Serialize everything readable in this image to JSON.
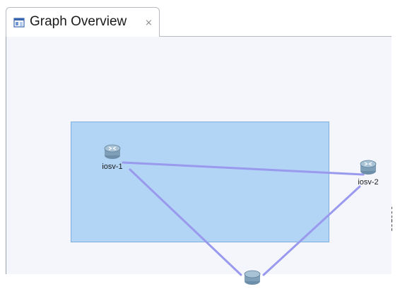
{
  "tab": {
    "title": "Graph Overview",
    "icon": "graph-view-icon",
    "close_icon": "close-icon"
  },
  "graph": {
    "nodes": [
      {
        "label": "iosv-1",
        "icon": "router-icon"
      },
      {
        "label": "iosv-2",
        "icon": "router-icon"
      },
      {
        "label": "",
        "icon": "router-icon"
      }
    ],
    "link_color": "#9999ee",
    "viewport_color": "#9fccf3"
  },
  "figure_id": "391090"
}
